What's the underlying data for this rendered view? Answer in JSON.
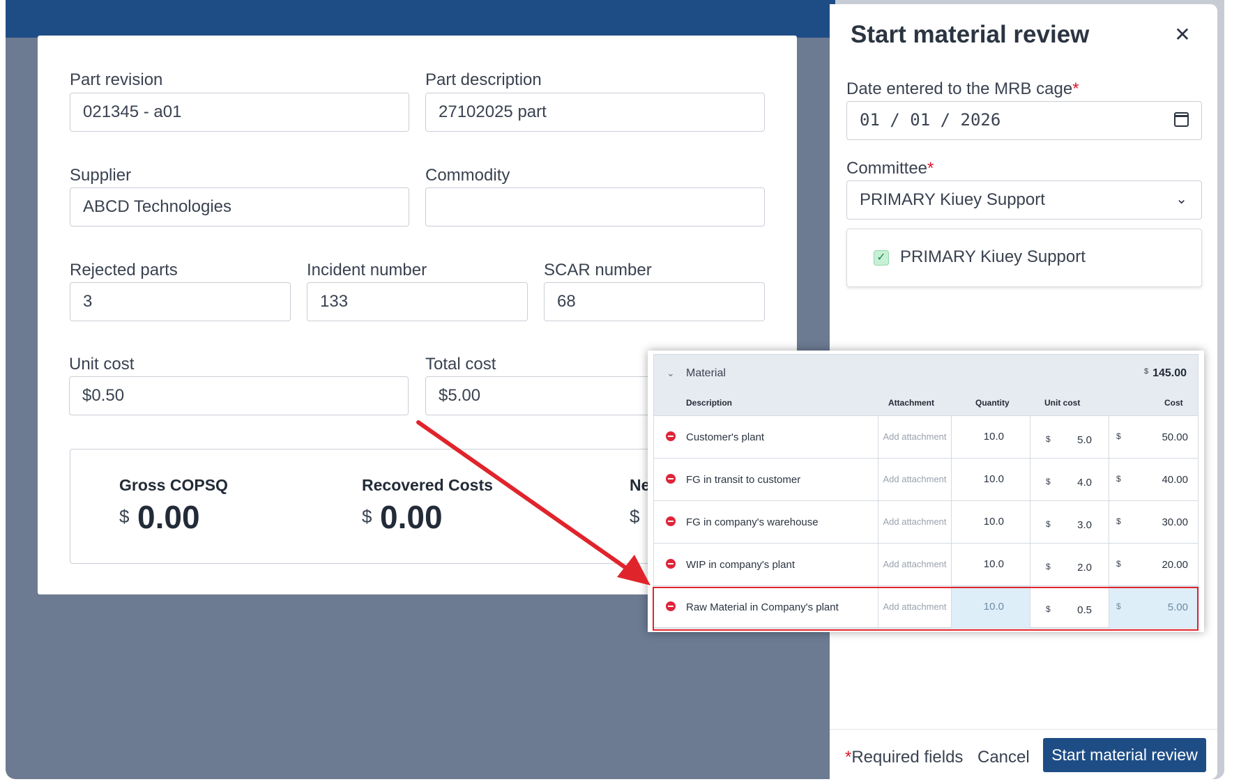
{
  "form": {
    "part_revision": {
      "label": "Part revision",
      "value": "021345 - a01"
    },
    "part_description": {
      "label": "Part description",
      "value": "27102025 part"
    },
    "supplier": {
      "label": "Supplier",
      "value": "ABCD Technologies"
    },
    "commodity": {
      "label": "Commodity",
      "value": ""
    },
    "rejected_parts": {
      "label": "Rejected parts",
      "value": "3"
    },
    "incident_number": {
      "label": "Incident number",
      "value": "133"
    },
    "scar_number": {
      "label": "SCAR number",
      "value": "68"
    },
    "unit_cost": {
      "label": "Unit cost",
      "value": "$0.50"
    },
    "total_cost": {
      "label": "Total cost",
      "value": "$5.00"
    }
  },
  "summary": {
    "gross": {
      "label": "Gross COPSQ",
      "currency": "$",
      "value": "0.00"
    },
    "recovered": {
      "label": "Recovered Costs",
      "currency": "$",
      "value": "0.00"
    },
    "net": {
      "label": "Ne",
      "currency": "$"
    }
  },
  "panel": {
    "title": "Start material review",
    "close_icon": "close-icon",
    "date_label": "Date entered to the MRB cage",
    "date_value": "01 / 01 / 2026",
    "committee_label": "Committee",
    "committee_value": "PRIMARY Kiuey Support",
    "committee_checked": "PRIMARY Kiuey Support",
    "required_mark": "*",
    "footer_required": "Required fields",
    "cancel_label": "Cancel",
    "start_label": "Start material review"
  },
  "material": {
    "title": "Material",
    "total_currency": "$",
    "total": "145.00",
    "columns": {
      "description": "Description",
      "attachment": "Attachment",
      "quantity": "Quantity",
      "unit_cost": "Unit cost",
      "cost": "Cost"
    },
    "add_attachment": "Add attachment",
    "currency": "$",
    "rows": [
      {
        "description": "Customer's plant",
        "quantity": "10.0",
        "unit_cost": "5.0",
        "cost": "50.00"
      },
      {
        "description": "FG in transit to customer",
        "quantity": "10.0",
        "unit_cost": "4.0",
        "cost": "40.00"
      },
      {
        "description": "FG in company's warehouse",
        "quantity": "10.0",
        "unit_cost": "3.0",
        "cost": "30.00"
      },
      {
        "description": "WIP in company's plant",
        "quantity": "10.0",
        "unit_cost": "2.0",
        "cost": "20.00"
      },
      {
        "description": "Raw Material in Company's plant",
        "quantity": "10.0",
        "unit_cost": "0.5",
        "cost": "5.00"
      }
    ]
  },
  "colors": {
    "accent": "#1e4d86",
    "annotation": "#e0242b",
    "highlight": "#deeef9"
  }
}
